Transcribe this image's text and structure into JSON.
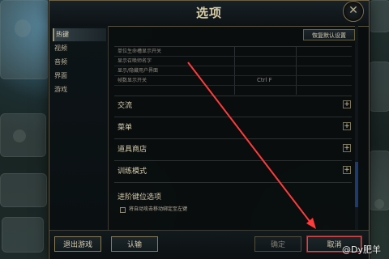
{
  "window": {
    "title": "选项"
  },
  "sidebar": {
    "items": [
      {
        "label": "热键",
        "active": true
      },
      {
        "label": "视频",
        "active": false
      },
      {
        "label": "音频",
        "active": false
      },
      {
        "label": "界面",
        "active": false
      },
      {
        "label": "游戏",
        "active": false
      }
    ]
  },
  "content": {
    "restore_label": "恢复默认设置",
    "table_rows": [
      {
        "label": "单位生命槽显示开关",
        "key": ""
      },
      {
        "label": "显示召唤师名字",
        "key": ""
      },
      {
        "label": "显示/隐藏用户界面",
        "key": ""
      },
      {
        "label": "帧数显示开关",
        "key": "Ctrl  F"
      }
    ],
    "sections": [
      {
        "label": "交流"
      },
      {
        "label": "菜单"
      },
      {
        "label": "道具商店"
      },
      {
        "label": "训练模式"
      }
    ],
    "advanced": {
      "title": "进阶键位选项",
      "checkbox_label": "将自动攻击移动绑定至左键"
    }
  },
  "footer": {
    "exit_game_label": "退出游戏",
    "surrender_label": "认输",
    "confirm_label": "确定",
    "cancel_label": "取消"
  },
  "watermark": {
    "text": "@Dy肥羊"
  },
  "colors": {
    "accent_gold": "#8b7c54",
    "highlight_red": "#d44a4a",
    "scroll_blue": "#1f3a73"
  }
}
